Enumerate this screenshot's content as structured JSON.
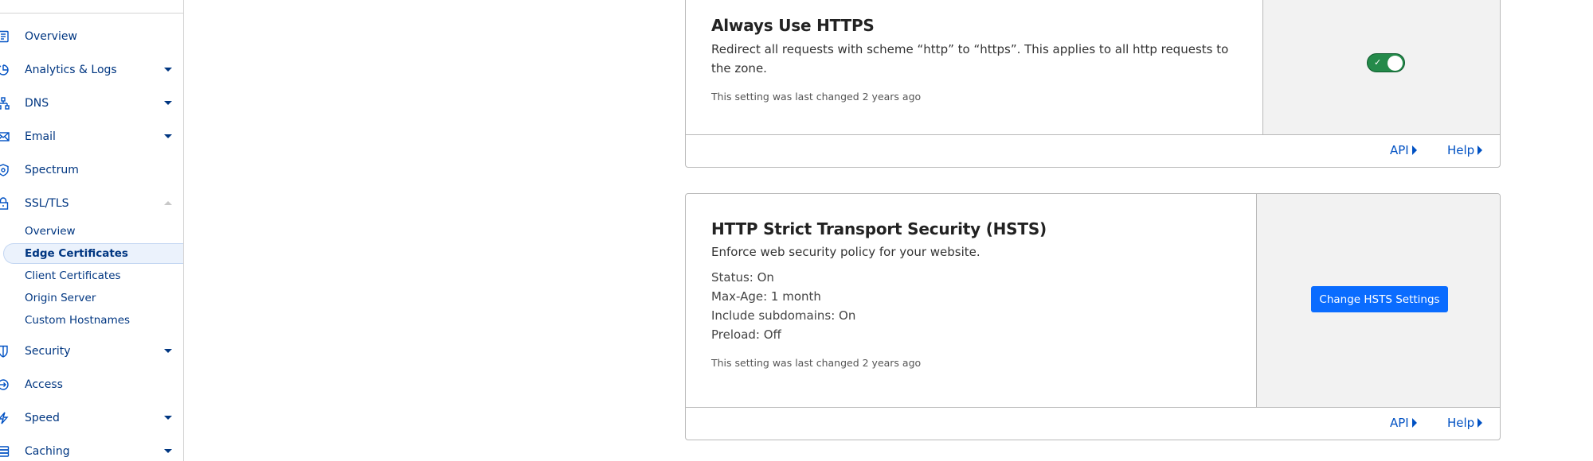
{
  "sidebar": {
    "items": [
      {
        "label": "Overview",
        "icon": "document-icon",
        "expandable": false
      },
      {
        "label": "Analytics & Logs",
        "icon": "pie-chart-icon",
        "expandable": true
      },
      {
        "label": "DNS",
        "icon": "network-icon",
        "expandable": true
      },
      {
        "label": "Email",
        "icon": "envelope-icon",
        "expandable": true
      },
      {
        "label": "Spectrum",
        "icon": "shield-gear-icon",
        "expandable": false
      },
      {
        "label": "SSL/TLS",
        "icon": "lock-icon",
        "expandable": true,
        "expanded": true
      },
      {
        "label": "Security",
        "icon": "shield-icon",
        "expandable": true
      },
      {
        "label": "Access",
        "icon": "access-icon",
        "expandable": false
      },
      {
        "label": "Speed",
        "icon": "lightning-icon",
        "expandable": true
      },
      {
        "label": "Caching",
        "icon": "server-stack-icon",
        "expandable": true
      }
    ],
    "ssl_subitems": [
      {
        "label": "Overview",
        "active": false
      },
      {
        "label": "Edge Certificates",
        "active": true
      },
      {
        "label": "Client Certificates",
        "active": false
      },
      {
        "label": "Origin Server",
        "active": false
      },
      {
        "label": "Custom Hostnames",
        "active": false
      }
    ]
  },
  "cards": {
    "always_https": {
      "title": "Always Use HTTPS",
      "description": "Redirect all requests with scheme “http” to “https”. This applies to all http requests to the zone.",
      "last_changed": "This setting was last changed 2 years ago",
      "toggle": {
        "state": "on",
        "check_glyph": "✓"
      },
      "api_label": "API",
      "help_label": "Help"
    },
    "hsts": {
      "title": "HTTP Strict Transport Security (HSTS)",
      "description": "Enforce web security policy for your website.",
      "details": [
        "Status: On",
        "Max-Age: 1 month",
        "Include subdomains: On",
        "Preload: Off"
      ],
      "last_changed": "This setting was last changed 2 years ago",
      "button_label": "Change HSTS Settings",
      "api_label": "API",
      "help_label": "Help"
    }
  },
  "colors": {
    "link": "#0051c3",
    "nav_text": "#003681",
    "toggle_on": "#248a4a",
    "primary_button": "#0a6cff",
    "panel_bg": "#f2f2f2"
  }
}
